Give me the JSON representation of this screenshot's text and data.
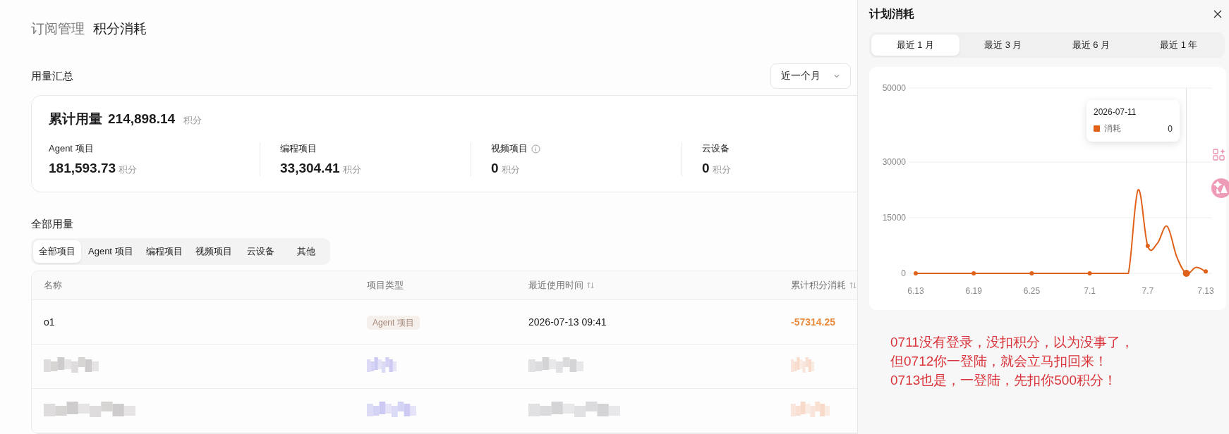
{
  "breadcrumb": [
    {
      "label": "订阅管理",
      "current": false
    },
    {
      "label": "积分消耗",
      "current": true
    }
  ],
  "summary": {
    "title": "用量汇总",
    "range": "近一个月",
    "total_label": "累计用量",
    "total_value": "214,898.14",
    "total_unit": "积分",
    "stats": [
      {
        "label": "Agent 项目",
        "value": "181,593.73",
        "unit": "积分",
        "info": false
      },
      {
        "label": "编程项目",
        "value": "33,304.41",
        "unit": "积分",
        "info": false
      },
      {
        "label": "视频项目",
        "value": "0",
        "unit": "积分",
        "info": true
      },
      {
        "label": "云设备",
        "value": "0",
        "unit": "积分",
        "info": false
      }
    ]
  },
  "usage": {
    "title": "全部用量",
    "tabs": [
      {
        "label": "全部项目",
        "selected": true
      },
      {
        "label": "Agent 项目",
        "selected": false
      },
      {
        "label": "编程项目",
        "selected": false
      },
      {
        "label": "视频项目",
        "selected": false
      },
      {
        "label": "云设备",
        "selected": false
      },
      {
        "label": "其他",
        "selected": false
      }
    ],
    "columns": [
      {
        "label": "名称",
        "sortable": false
      },
      {
        "label": "项目类型",
        "sortable": false
      },
      {
        "label": "最近使用时间",
        "sortable": true
      },
      {
        "label": "累计积分消耗",
        "sortable": true
      }
    ],
    "rows": [
      {
        "kind": "data",
        "name": "o1",
        "type": "Agent 项目",
        "time": "2026-07-13 09:41",
        "total": "-57314.25"
      },
      {
        "kind": "redacted"
      },
      {
        "kind": "redacted"
      }
    ]
  },
  "panel": {
    "title": "计划消耗",
    "ranges": [
      {
        "label": "最近 1 月",
        "selected": true
      },
      {
        "label": "最近 3 月",
        "selected": false
      },
      {
        "label": "最近 6 月",
        "selected": false
      },
      {
        "label": "最近 1 年",
        "selected": false
      }
    ],
    "chart_data": {
      "type": "line",
      "categories": [
        "6.13",
        null,
        null,
        null,
        null,
        null,
        "6.19",
        null,
        null,
        null,
        null,
        null,
        "6.25",
        null,
        null,
        null,
        null,
        null,
        "7.1",
        null,
        null,
        null,
        null,
        null,
        "7.7",
        null,
        null,
        null,
        null,
        null,
        "7.13"
      ],
      "yticks": [
        0,
        15000,
        30000,
        50000
      ],
      "ylim": [
        0,
        50000
      ],
      "series": [
        {
          "name": "消耗",
          "color": "#e0621a",
          "values": [
            0,
            0,
            0,
            0,
            0,
            0,
            0,
            0,
            0,
            0,
            0,
            0,
            0,
            0,
            0,
            0,
            0,
            0,
            0,
            0,
            0,
            0,
            0,
            22500,
            7400,
            8100,
            12700,
            4500,
            0,
            1600,
            500
          ]
        }
      ]
    },
    "tooltip": {
      "title": "2026-07-11",
      "values": [
        "0"
      ]
    },
    "note": [
      "0711没有登录，没扣积分，以为没事了，",
      "但0712你一登陆，就会立马扣回来！",
      "0713也是，一登陆，先扣你500积分！"
    ]
  }
}
